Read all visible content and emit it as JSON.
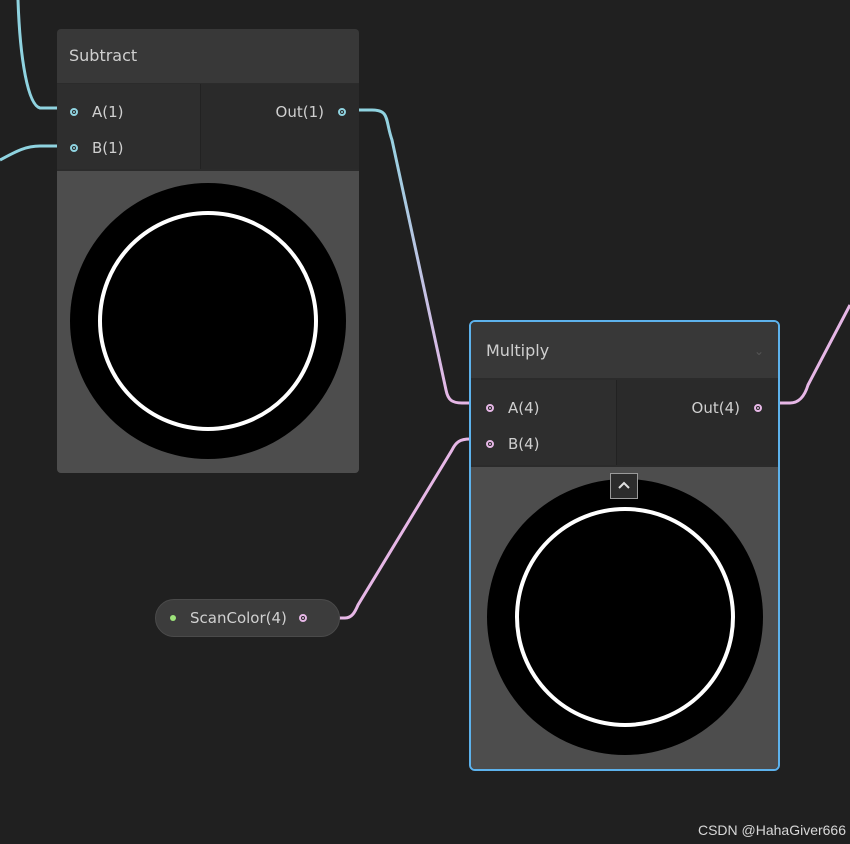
{
  "subtract_node": {
    "title": "Subtract",
    "inputs": [
      "A(1)",
      "B(1)"
    ],
    "output": "Out(1)"
  },
  "multiply_node": {
    "title": "Multiply",
    "inputs": [
      "A(4)",
      "B(4)"
    ],
    "output": "Out(4)",
    "selected": true
  },
  "property_node": {
    "label": "ScanColor(4)"
  },
  "watermark": "CSDN @HahaGiver666",
  "colors": {
    "background": "#202020",
    "wire_float": "#8fd3e0",
    "wire_vector4": "#e6b7e6",
    "selection": "#5db2ec",
    "property_dot": "#9de37a"
  }
}
